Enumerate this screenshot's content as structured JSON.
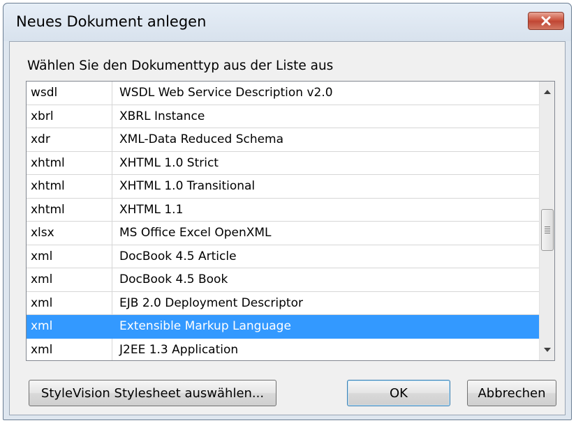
{
  "window": {
    "title": "Neues Dokument anlegen",
    "close_icon": "close-x-icon"
  },
  "dialog": {
    "prompt": "Wählen Sie den Dokumenttyp aus der Liste aus",
    "selected_index": 10,
    "colors": {
      "selection": "#3399ff",
      "close_button": "#c9503b"
    },
    "items": [
      {
        "ext": "wsdl",
        "desc": "WSDL Web Service Description v2.0"
      },
      {
        "ext": "xbrl",
        "desc": "XBRL Instance"
      },
      {
        "ext": "xdr",
        "desc": "XML-Data Reduced Schema"
      },
      {
        "ext": "xhtml",
        "desc": "XHTML 1.0 Strict"
      },
      {
        "ext": "xhtml",
        "desc": "XHTML 1.0 Transitional"
      },
      {
        "ext": "xhtml",
        "desc": "XHTML 1.1"
      },
      {
        "ext": "xlsx",
        "desc": "MS Office Excel OpenXML"
      },
      {
        "ext": "xml",
        "desc": "DocBook 4.5 Article"
      },
      {
        "ext": "xml",
        "desc": "DocBook 4.5 Book"
      },
      {
        "ext": "xml",
        "desc": "EJB 2.0 Deployment Descriptor"
      },
      {
        "ext": "xml",
        "desc": "Extensible Markup Language"
      },
      {
        "ext": "xml",
        "desc": "J2EE 1.3 Application"
      }
    ]
  },
  "buttons": {
    "stylesheet": "StyleVision Stylesheet auswählen...",
    "ok": "OK",
    "cancel": "Abbrechen"
  }
}
